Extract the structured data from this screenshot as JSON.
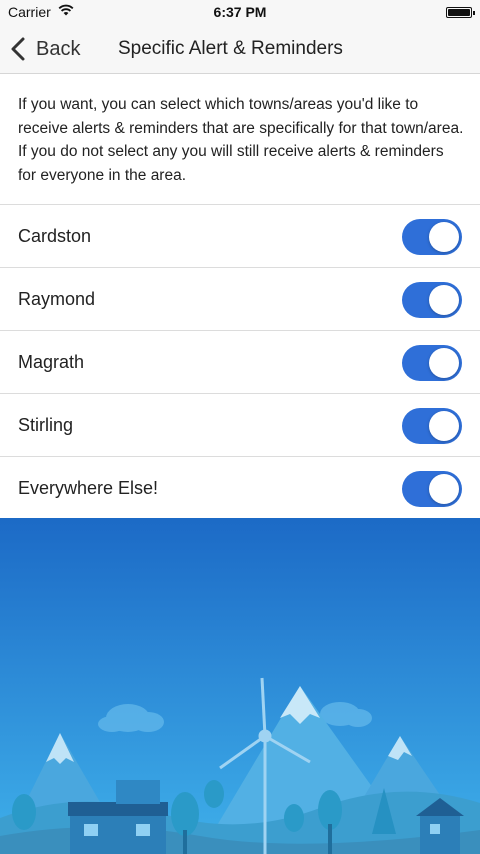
{
  "status_bar": {
    "carrier": "Carrier",
    "time": "6:37 PM",
    "wifi_icon": "wifi-icon",
    "battery_icon": "battery-icon"
  },
  "nav": {
    "back_label": "Back",
    "back_icon": "chevron-left-icon",
    "title": "Specific Alert & Reminders"
  },
  "intro_text": "If you want, you can select which towns/areas you'd like to receive alerts & reminders that are specifically for that town/area. If you do not select any you will still receive alerts & reminders for everyone in the area.",
  "towns": [
    {
      "label": "Cardston",
      "enabled": true
    },
    {
      "label": "Raymond",
      "enabled": true
    },
    {
      "label": "Magrath",
      "enabled": true
    },
    {
      "label": "Stirling",
      "enabled": true
    },
    {
      "label": "Everywhere Else!",
      "enabled": true
    }
  ],
  "colors": {
    "toggle_on": "#2f6fd8",
    "sky_top": "#1e6fc9",
    "sky_bottom": "#3ea9e6"
  }
}
